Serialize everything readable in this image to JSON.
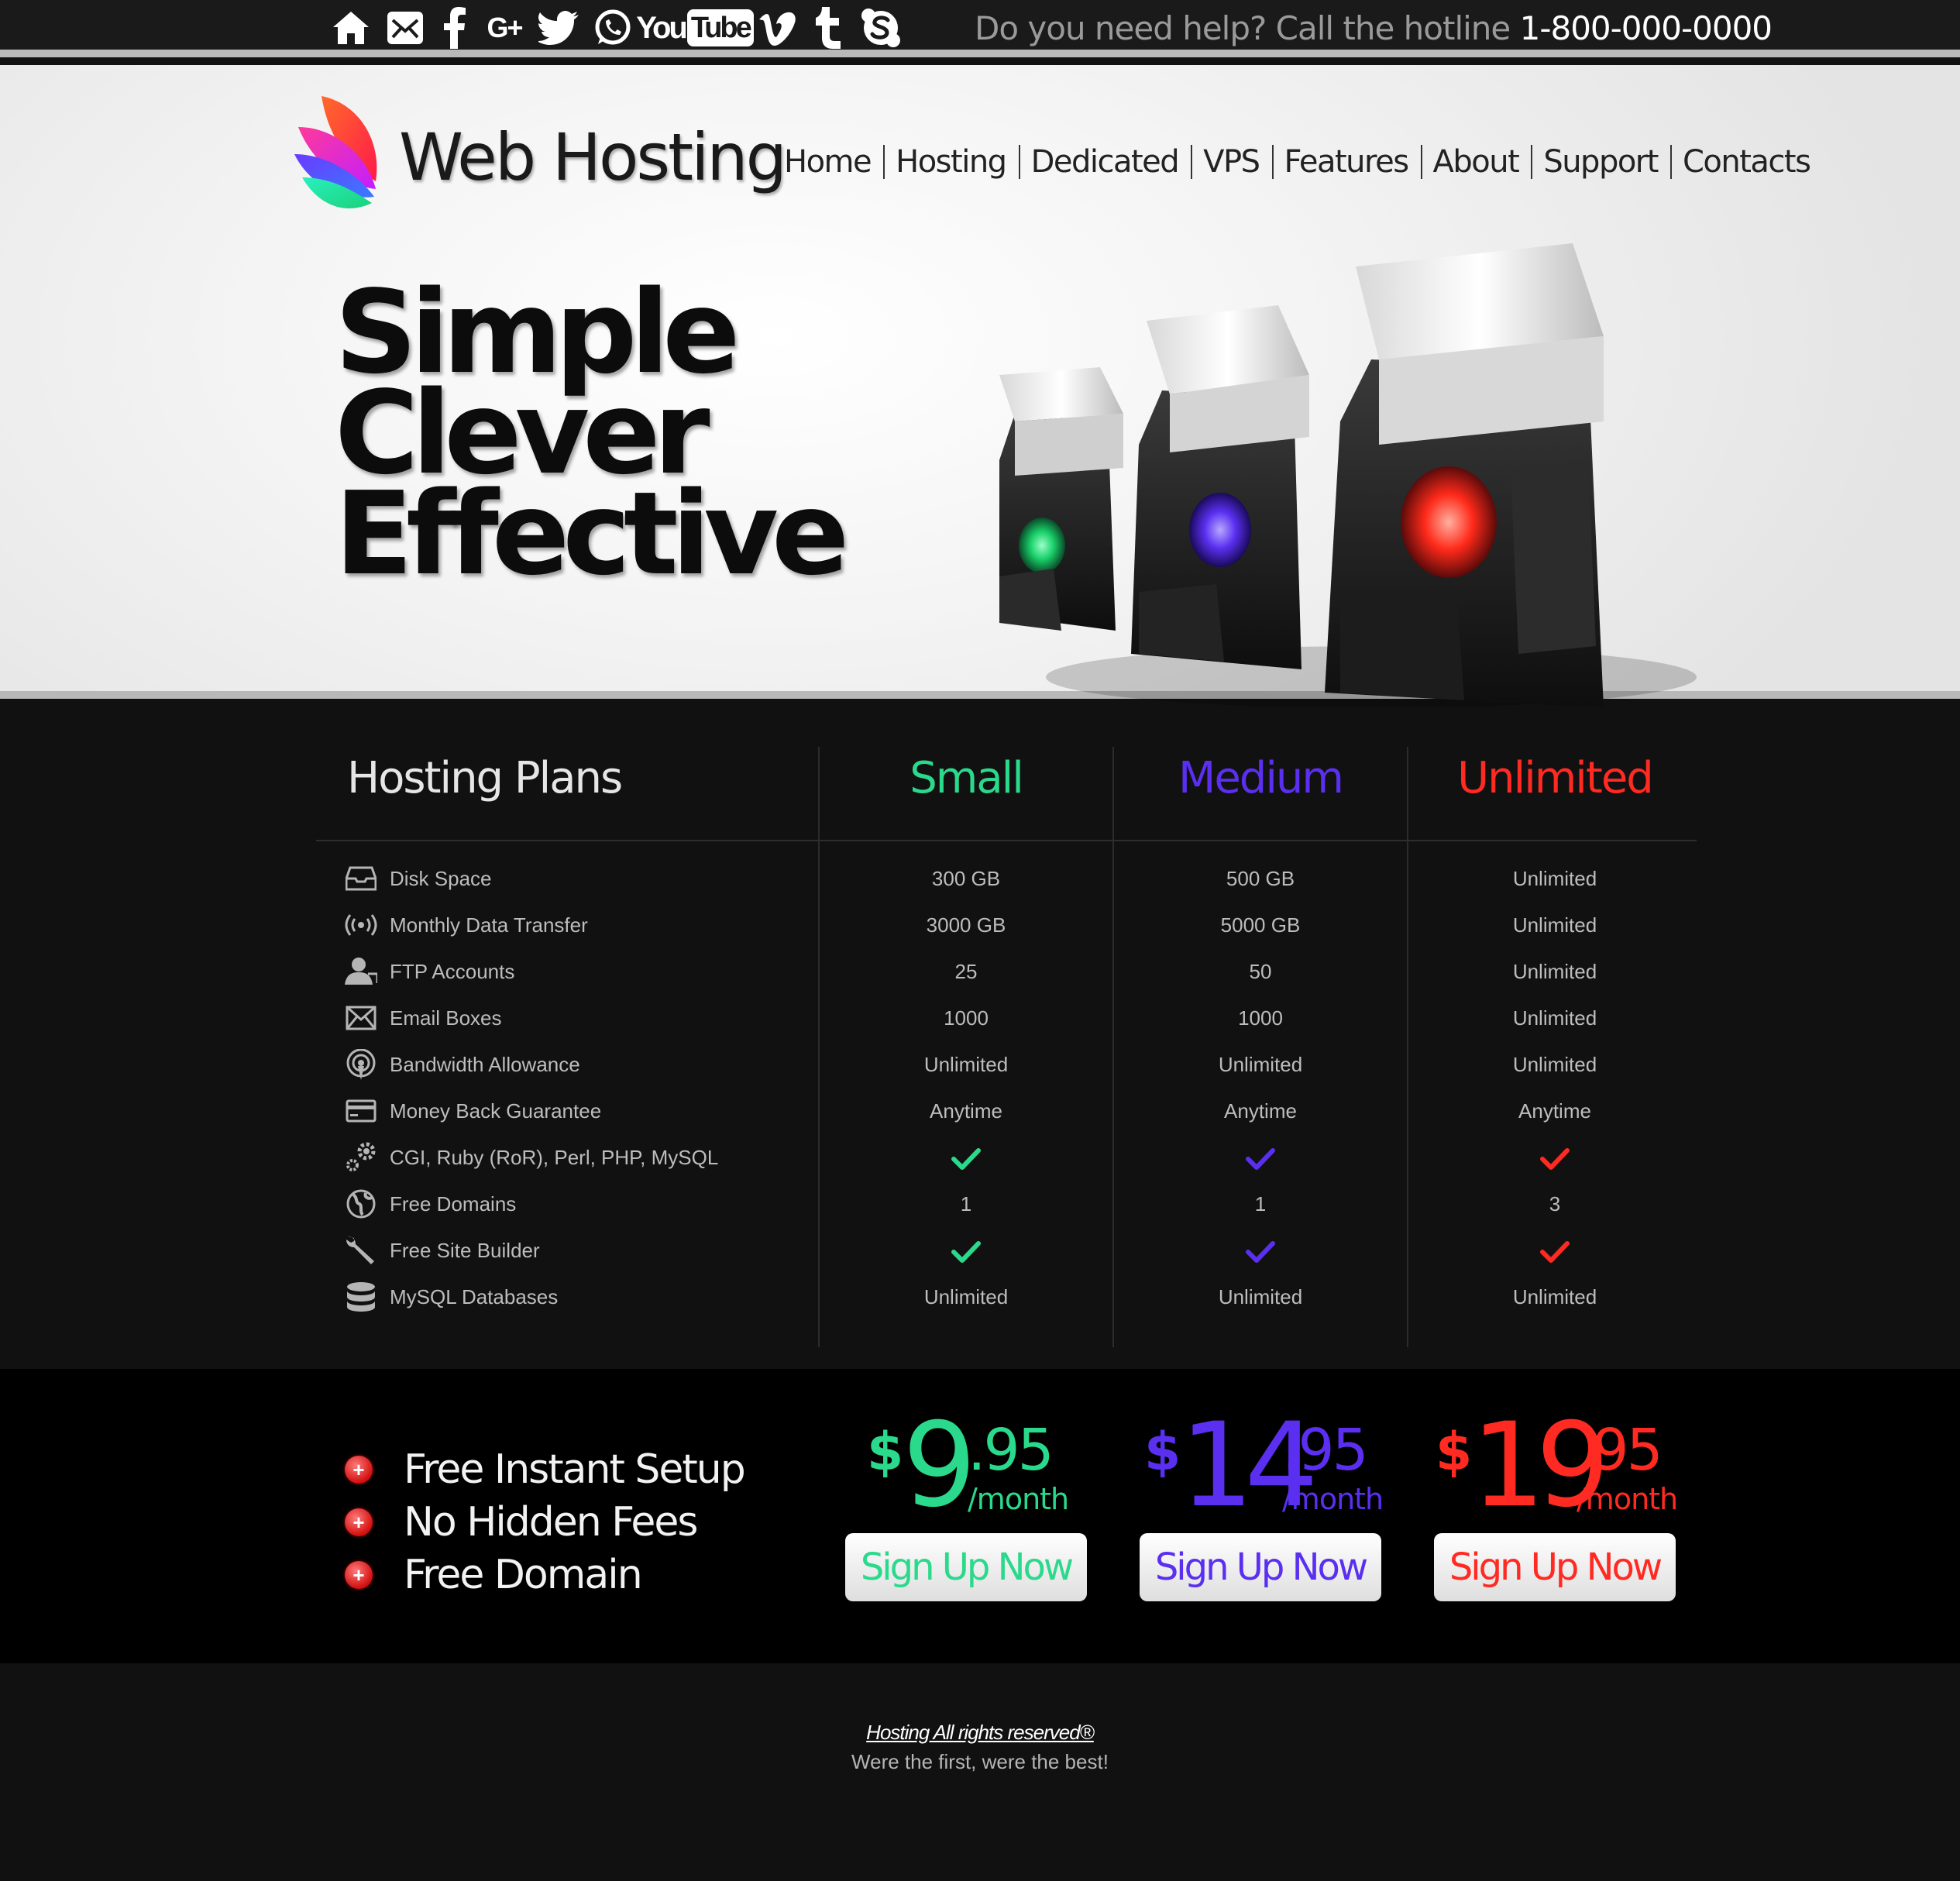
{
  "social": [
    "home-icon",
    "mail-icon",
    "facebook-icon",
    "google-plus-icon",
    "twitter-icon",
    "whatsapp-icon",
    "youtube-icon",
    "vimeo-icon",
    "tumblr-icon",
    "skype-icon"
  ],
  "social_text": {
    "googleplus": "G+",
    "youtube_you": "You",
    "youtube_tube": "Tube"
  },
  "hotline": {
    "text": "Do you need help? Call the hotline ",
    "number": "1-800-000-0000"
  },
  "brand": "Web Hosting",
  "nav": [
    "Home",
    "Hosting",
    "Dedicated",
    "VPS",
    "Features",
    "About",
    "Support",
    "Contacts"
  ],
  "hero": {
    "line1": "Simple",
    "line2": "Clever",
    "line3": "Effective"
  },
  "plans": {
    "title": "Hosting Plans",
    "columns": [
      {
        "name": "Small",
        "color": "#2bd98c"
      },
      {
        "name": "Medium",
        "color": "#5a2ff0"
      },
      {
        "name": "Unlimited",
        "color": "#ff2a22"
      }
    ],
    "features": [
      {
        "label": "Disk Space",
        "icon": "disk-icon",
        "values": [
          "300 GB",
          "500 GB",
          "Unlimited"
        ]
      },
      {
        "label": "Monthly Data Transfer",
        "icon": "signal-icon",
        "values": [
          "3000 GB",
          "5000 GB",
          "Unlimited"
        ]
      },
      {
        "label": "FTP Accounts",
        "icon": "user-icon",
        "values": [
          "25",
          "50",
          "Unlimited"
        ]
      },
      {
        "label": "Email Boxes",
        "icon": "envelope-icon",
        "values": [
          "1000",
          "1000",
          "Unlimited"
        ]
      },
      {
        "label": "Bandwidth Allowance",
        "icon": "broadcast-icon",
        "values": [
          "Unlimited",
          "Unlimited",
          "Unlimited"
        ]
      },
      {
        "label": "Money Back Guarantee",
        "icon": "credit-card-icon",
        "values": [
          "Anytime",
          "Anytime",
          "Anytime"
        ]
      },
      {
        "label": "CGI, Ruby (RoR), Perl, PHP, MySQL",
        "icon": "gears-icon",
        "values": [
          "check",
          "check",
          "check"
        ]
      },
      {
        "label": "Free Domains",
        "icon": "globe-icon",
        "values": [
          "1",
          "1",
          "3"
        ]
      },
      {
        "label": "Free Site Builder",
        "icon": "wrench-icon",
        "values": [
          "check",
          "check",
          "check"
        ]
      },
      {
        "label": "MySQL Databases",
        "icon": "database-icon",
        "values": [
          "Unlimited",
          "Unlimited",
          "Unlimited"
        ]
      }
    ]
  },
  "perks": [
    "Free Instant Setup",
    "No Hidden Fees",
    "Free Domain"
  ],
  "prices": [
    {
      "currency": "$",
      "whole": "9",
      "cents": ".95",
      "per": "/month",
      "button": "Sign Up Now",
      "color": "#2bd98c"
    },
    {
      "currency": "$",
      "whole": "14",
      "cents": ".95",
      "per": "/month",
      "button": "Sign Up Now",
      "color": "#5a2ff0"
    },
    {
      "currency": "$",
      "whole": "19",
      "cents": ".95",
      "per": "/month",
      "button": "Sign Up Now",
      "color": "#ff2a22"
    }
  ],
  "footer": {
    "copyright": "Hosting All rights reserved®",
    "tagline": "Were the first, were the best!"
  }
}
